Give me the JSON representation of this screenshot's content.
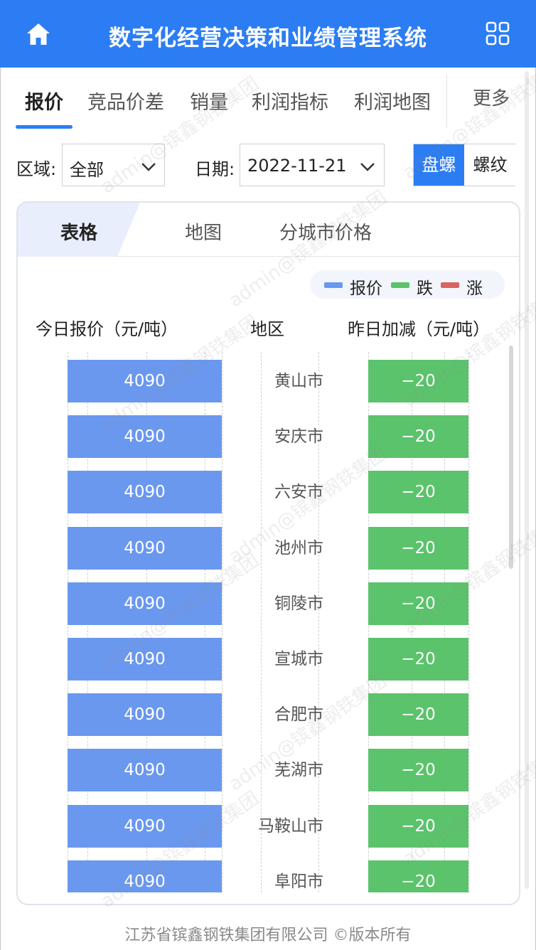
{
  "header": {
    "title": "数字化经营决策和业绩管理系统",
    "home_icon": "home-icon",
    "apps_icon": "apps-grid-icon"
  },
  "nav": {
    "tabs": [
      {
        "label": "报价",
        "active": true
      },
      {
        "label": "竞品价差",
        "active": false
      },
      {
        "label": "销量",
        "active": false
      },
      {
        "label": "利润指标",
        "active": false
      },
      {
        "label": "利润地图",
        "active": false
      }
    ],
    "more_label": "更多"
  },
  "filters": {
    "region_label": "区域:",
    "region_value": "全部",
    "date_label": "日期:",
    "date_value": "2022-11-21",
    "product_options": [
      {
        "label": "盘螺",
        "selected": true
      },
      {
        "label": "螺纹",
        "selected": false
      }
    ]
  },
  "card": {
    "tabs": [
      {
        "label": "表格",
        "active": true
      },
      {
        "label": "地图",
        "active": false
      },
      {
        "label": "分城市价格",
        "active": false
      }
    ],
    "legend": [
      {
        "label": "报价",
        "color": "#6a98ef"
      },
      {
        "label": "跌",
        "color": "#5bc36b"
      },
      {
        "label": "涨",
        "color": "#d9635f"
      }
    ],
    "columns": {
      "price": "今日报价（元/吨）",
      "region": "地区",
      "change": "昨日加减（元/吨）"
    },
    "rows": [
      {
        "price": "4090",
        "city": "黄山市",
        "change": "−20"
      },
      {
        "price": "4090",
        "city": "安庆市",
        "change": "−20"
      },
      {
        "price": "4090",
        "city": "六安市",
        "change": "−20"
      },
      {
        "price": "4090",
        "city": "池州市",
        "change": "−20"
      },
      {
        "price": "4090",
        "city": "铜陵市",
        "change": "−20"
      },
      {
        "price": "4090",
        "city": "宣城市",
        "change": "−20"
      },
      {
        "price": "4090",
        "city": "合肥市",
        "change": "−20"
      },
      {
        "price": "4090",
        "city": "芜湖市",
        "change": "−20"
      },
      {
        "price": "4090",
        "city": "马鞍山市",
        "change": "−20"
      },
      {
        "price": "4090",
        "city": "阜阳市",
        "change": "−20"
      }
    ]
  },
  "footer": {
    "copyright": "江苏省镔鑫钢铁集团有限公司 ©版本所有"
  },
  "watermark": "admin@镔鑫钢铁集团",
  "colors": {
    "brand": "#2c7df3",
    "price_bar": "#6a98ef",
    "fall": "#5bc36b",
    "rise": "#d9635f"
  }
}
